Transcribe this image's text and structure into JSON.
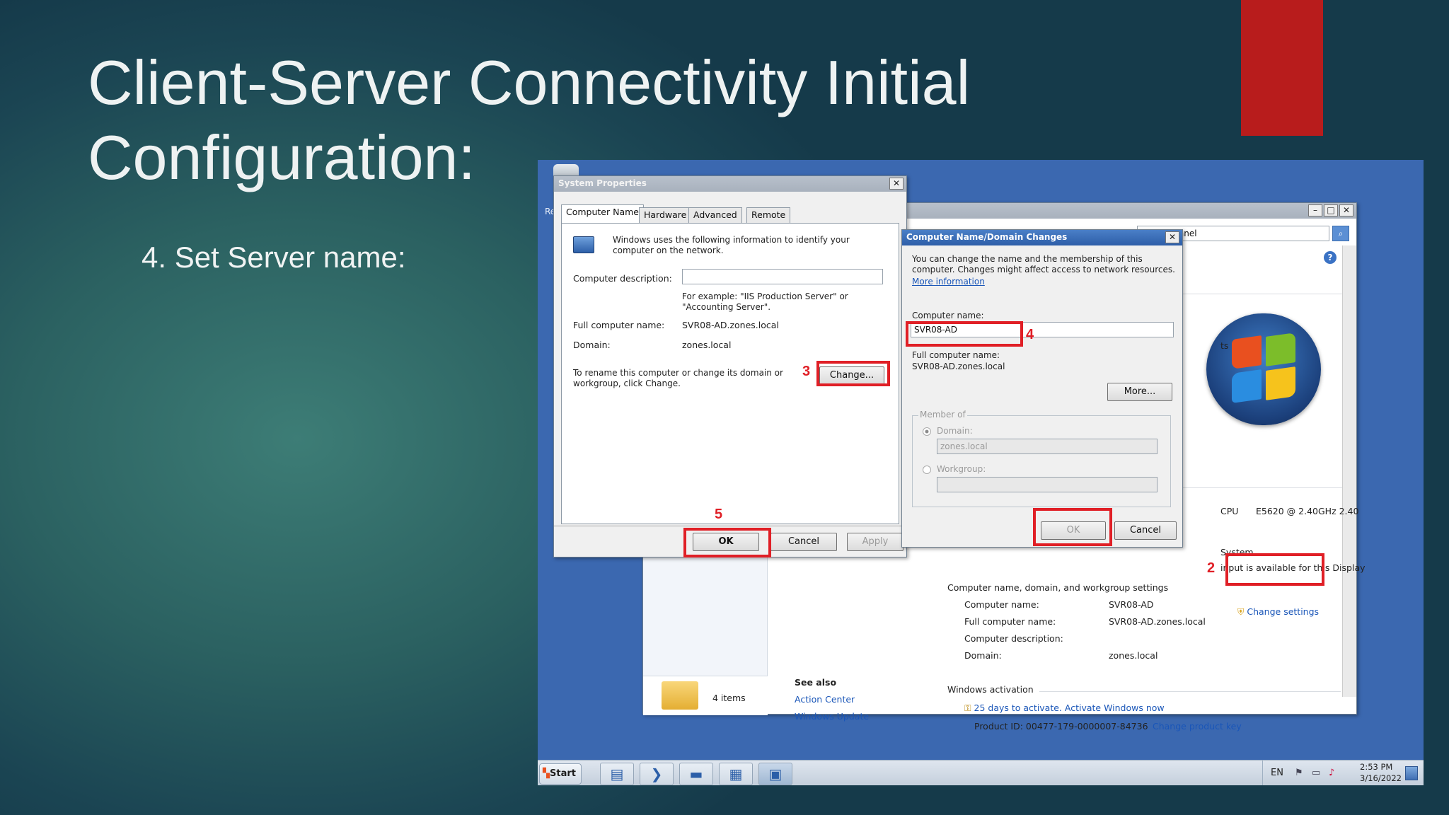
{
  "slide": {
    "title_line1": "Client-Server Connectivity Initial",
    "title_line2": "Configuration:",
    "bullet": "4. Set Server name:",
    "accent_color": "#b81c1c"
  },
  "desktop": {
    "icon_label": "Re"
  },
  "control_panel": {
    "address": "Control Panel",
    "cpu_label": "CPU",
    "cpu_value": "E5620  @ 2.40GHz   2.40",
    "system_label": "System",
    "pen_touch": "input is available for this Display",
    "performance_label": "ts",
    "section_computer": "Computer name, domain, and workgroup settings",
    "computer_name_label": "Computer name:",
    "computer_name_value": "SVR08-AD",
    "full_name_label": "Full computer name:",
    "full_name_value": "SVR08-AD.zones.local",
    "description_label": "Computer description:",
    "domain_label": "Domain:",
    "domain_value": "zones.local",
    "change_settings": "Change settings",
    "activation_section": "Windows activation",
    "activation_link": "25 days to activate. Activate Windows now",
    "product_id": "Product ID: 00477-179-0000007-84736",
    "change_key": "Change product key",
    "see_also": "See also",
    "action_center": "Action Center",
    "windows_update": "Windows Update",
    "items_count": "4 items"
  },
  "system_properties": {
    "title": "System Properties",
    "tabs": [
      "Computer Name",
      "Hardware",
      "Advanced",
      "Remote"
    ],
    "intro": "Windows uses the following information to identify your computer on the network.",
    "description_label": "Computer description:",
    "description_value": "",
    "example": "For example: \"IIS Production Server\" or \"Accounting Server\".",
    "full_name_label": "Full computer name:",
    "full_name_value": "SVR08-AD.zones.local",
    "domain_label": "Domain:",
    "domain_value": "zones.local",
    "rename_text": "To rename this computer or change its domain or workgroup, click Change.",
    "change_button": "Change...",
    "ok": "OK",
    "cancel": "Cancel",
    "apply": "Apply"
  },
  "domain_changes": {
    "title": "Computer Name/Domain Changes",
    "intro": "You can change the name and the membership of this computer. Changes might affect access to network resources.",
    "more_info": "More information",
    "computer_name_label": "Computer name:",
    "computer_name_value": "SVR08-AD",
    "full_name_label": "Full computer name:",
    "full_name_value": "SVR08-AD.zones.local",
    "more_button": "More...",
    "member_of": "Member of",
    "domain_option": "Domain:",
    "domain_value": "zones.local",
    "workgroup_option": "Workgroup:",
    "workgroup_value": "",
    "ok": "OK",
    "cancel": "Cancel"
  },
  "annotations": {
    "step2": "2",
    "step3": "3",
    "step4": "4",
    "step5": "5",
    "color": "#e01f26"
  },
  "taskbar": {
    "start": "Start",
    "language": "EN",
    "time": "2:53 PM",
    "date": "3/16/2022"
  }
}
